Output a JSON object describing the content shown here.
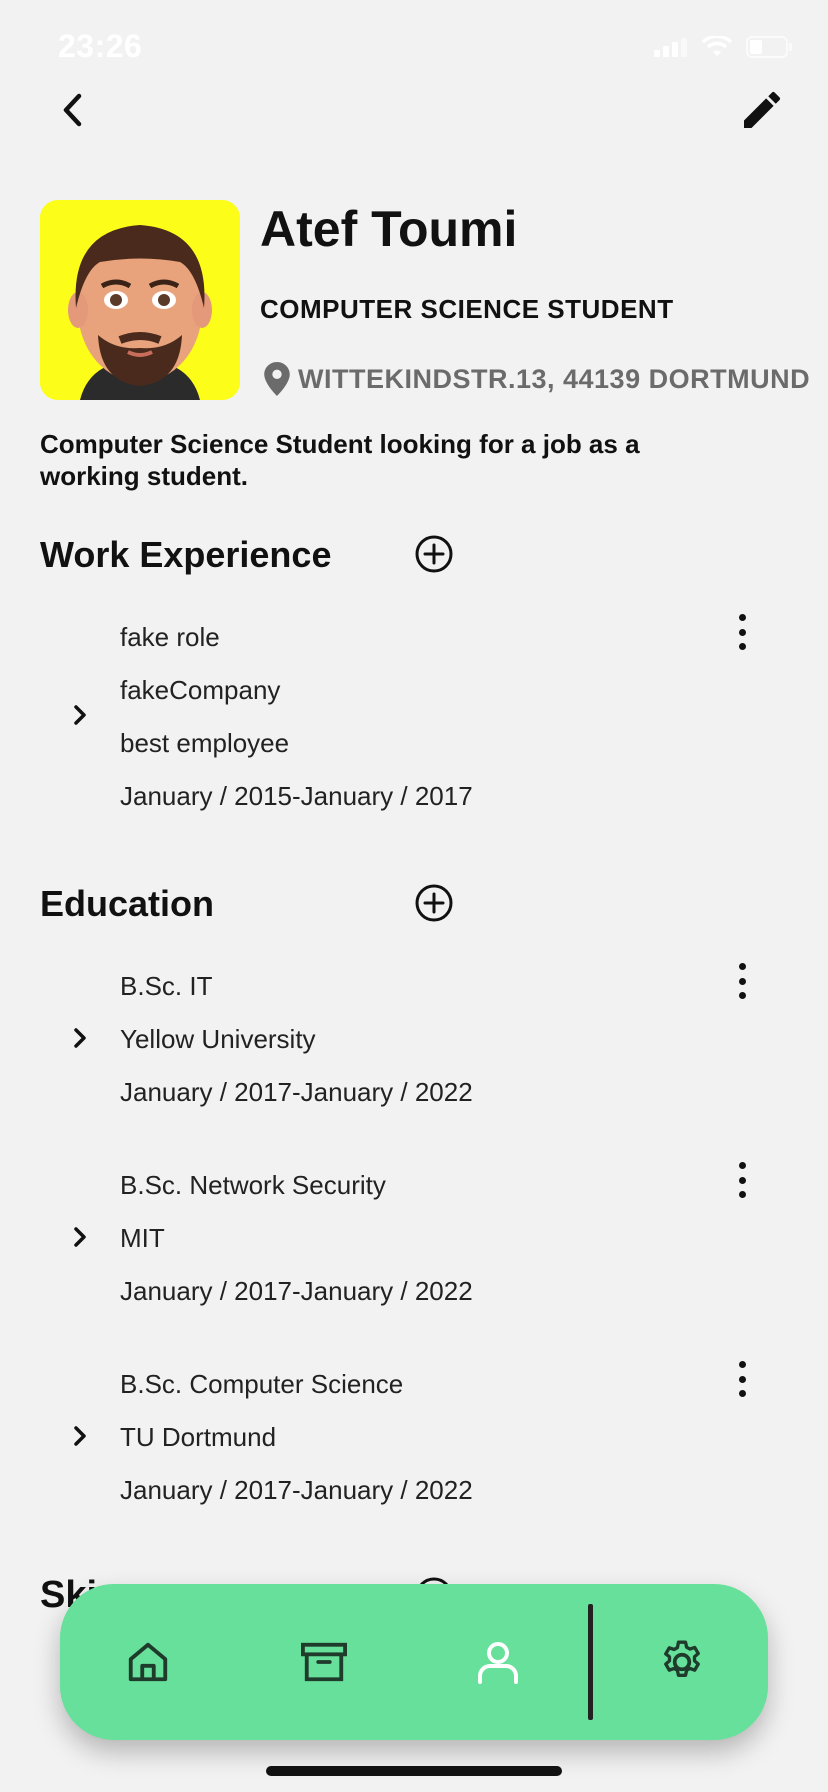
{
  "status_bar": {
    "time": "23:26"
  },
  "profile": {
    "name": "Atef Toumi",
    "title": "COMPUTER SCIENCE STUDENT",
    "location": "WITTEKINDSTR.13, 44139 DORTMUND",
    "bio": "Computer Science Student looking for a job as a working student."
  },
  "work_experience": {
    "title": "Work Experience",
    "items": [
      {
        "role": "fake role",
        "company": "fakeCompany",
        "description": "best employee",
        "dates": "January / 2015-January / 2017"
      }
    ]
  },
  "education": {
    "title": "Education",
    "items": [
      {
        "degree": "B.Sc. IT",
        "school": "Yellow University",
        "dates": "January / 2017-January / 2022"
      },
      {
        "degree": "B.Sc. Network Security",
        "school": "MIT",
        "dates": "January / 2017-January / 2022"
      },
      {
        "degree": "B.Sc. Computer Science",
        "school": "TU Dortmund",
        "dates": "January / 2017-January / 2022"
      }
    ]
  },
  "skills": {
    "title_partial": "Ski"
  },
  "bottom_nav": {
    "items": [
      {
        "icon": "home-icon"
      },
      {
        "icon": "archive-icon"
      },
      {
        "icon": "user-icon",
        "active": true
      },
      {
        "icon": "gear-icon"
      }
    ]
  },
  "colors": {
    "nav_background": "#66e09a",
    "active_icon": "#ffffff",
    "location_text": "#6b6b6b",
    "avatar_background": "#fdfd1a"
  }
}
